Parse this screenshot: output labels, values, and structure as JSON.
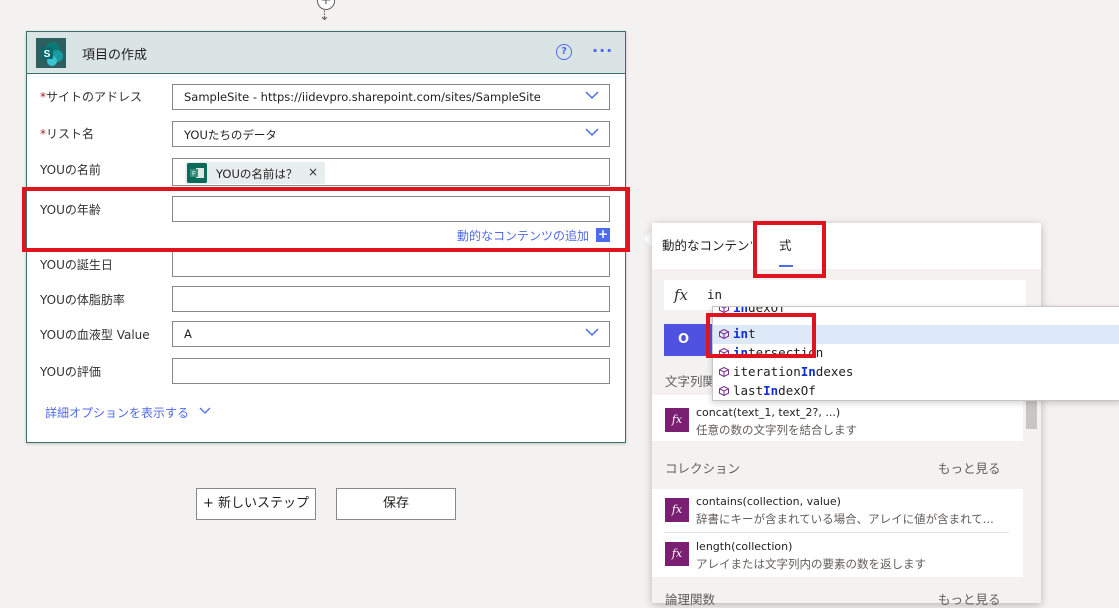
{
  "card": {
    "title": "項目の作成",
    "help": "?",
    "more": "···",
    "fields": {
      "site": {
        "label": "サイトのアドレス",
        "required": "*",
        "value": "SampleSite - https://iidevpro.sharepoint.com/sites/SampleSite"
      },
      "list": {
        "label": "リスト名",
        "required": "*",
        "value": "YOUたちのデータ"
      },
      "name": {
        "label": "YOUの名前",
        "token": "YOUの名前は？",
        "token_close": "×"
      },
      "age": {
        "label": "YOUの年齢",
        "value": ""
      },
      "birthday": {
        "label": "YOUの誕生日",
        "value": ""
      },
      "bodyfat": {
        "label": "YOUの体脂肪率",
        "value": ""
      },
      "blood": {
        "label": "YOUの血液型 Value",
        "value": "A"
      },
      "rating": {
        "label": "YOUの評価",
        "value": ""
      }
    },
    "dynamic_link": "動的なコンテンツの追加",
    "dynamic_plus": "+",
    "advanced_link": "詳細オプションを表示する"
  },
  "buttons": {
    "new_step": "+ 新しいステップ",
    "save": "保存"
  },
  "connector": {
    "plus": "+",
    "arrow": "⇣"
  },
  "flyout": {
    "tabs": {
      "dynamic": "動的なコンテンツ",
      "expression": "式"
    },
    "fx": "fx",
    "expression": "in",
    "ok": "O",
    "categories": {
      "string": {
        "title": "文字列関",
        "items": [
          {
            "name": "concat(text_1, text_2?, ...)",
            "desc": "任意の数の文字列を結合します"
          }
        ]
      },
      "collection": {
        "title": "コレクション",
        "more": "もっと見る",
        "items": [
          {
            "name": "contains(collection, value)",
            "desc": "辞書にキーが含まれている場合、アレイに値が含まれて..."
          },
          {
            "name": "length(collection)",
            "desc": "アレイまたは文字列内の要素の数を返します"
          }
        ]
      },
      "logic": {
        "title": "論理関数",
        "more": "もっと見る"
      }
    },
    "autocomplete": [
      {
        "pre": "",
        "match": "in",
        "post": "dexOf",
        "selected": false
      },
      {
        "pre": "",
        "match": "in",
        "post": "t",
        "selected": true
      },
      {
        "pre": "",
        "match": "in",
        "post": "tersection",
        "selected": false
      },
      {
        "pre": "iteration",
        "match": "In",
        "post": "dexes",
        "selected": false
      },
      {
        "pre": "last",
        "match": "In",
        "post": "dexOf",
        "selected": false
      }
    ]
  },
  "colors": {
    "accent": "#4f6bed",
    "highlight": "#e0141e",
    "header": "#dae4e4",
    "fx_tile": "#7a1f71"
  }
}
